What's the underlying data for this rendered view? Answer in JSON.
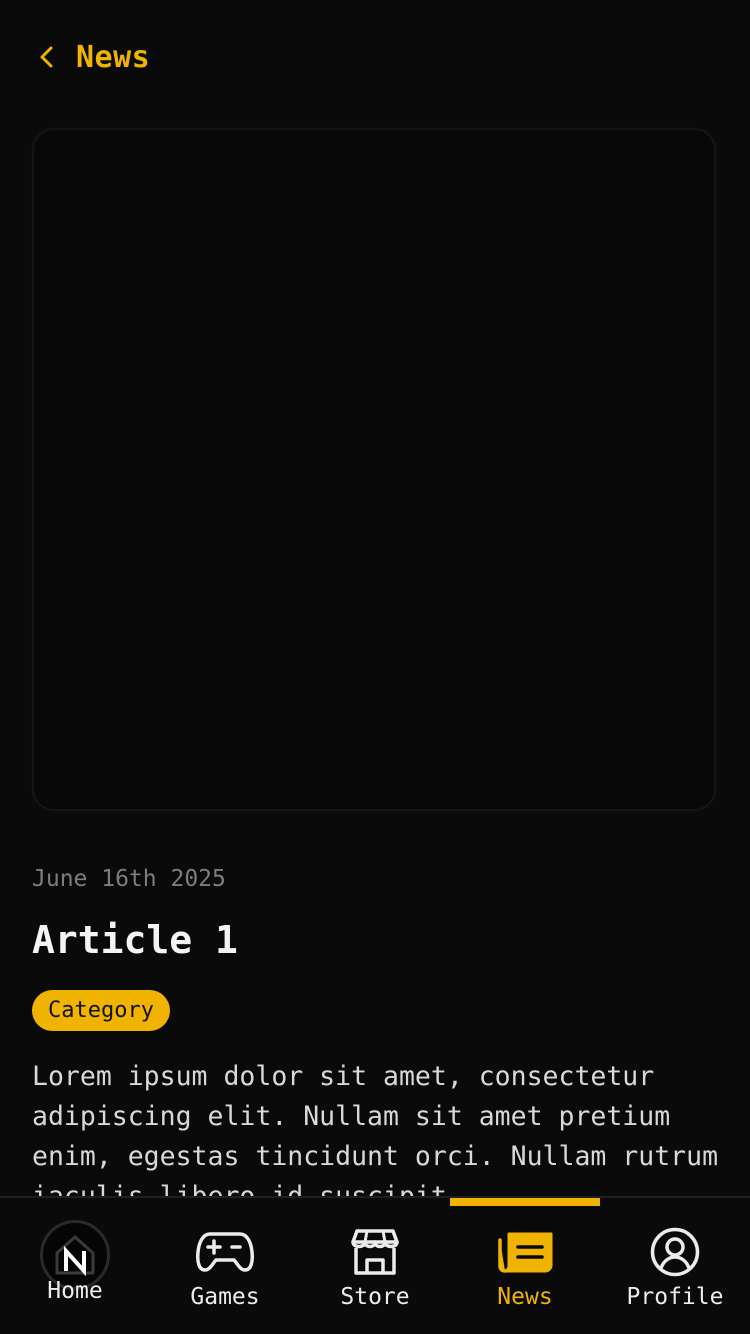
{
  "header": {
    "back_icon": "chevron-left-icon",
    "title": "News"
  },
  "article": {
    "date": "June 16th 2025",
    "title": "Article 1",
    "category": "Category",
    "body": "Lorem ipsum dolor sit amet, consectetur adipiscing elit. Nullam sit amet pretium enim, egestas tincidunt orci. Nullam rutrum iaculis libero id suscipit."
  },
  "nav": {
    "items": [
      {
        "label": "Home",
        "icon": "home-logo-icon"
      },
      {
        "label": "Games",
        "icon": "gamepad-icon"
      },
      {
        "label": "Store",
        "icon": "store-icon"
      },
      {
        "label": "News",
        "icon": "newspaper-icon"
      },
      {
        "label": "Profile",
        "icon": "profile-icon"
      }
    ],
    "active": "News"
  },
  "colors": {
    "accent": "#f0b400",
    "background": "#0a0a0a",
    "text": "#e6e6e6",
    "muted": "#7d7d7d"
  }
}
